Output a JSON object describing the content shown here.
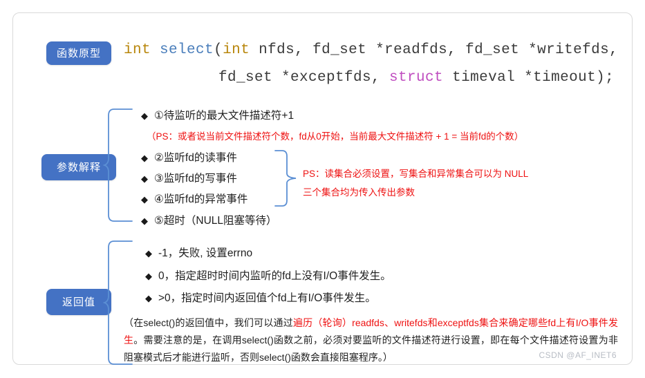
{
  "labels": {
    "prototype": "函数原型",
    "params": "参数解释",
    "return": "返回值"
  },
  "signature": {
    "line1": {
      "kw_int": "int",
      "fn_name": "select",
      "open_paren": "(",
      "kw_int2": "int",
      "rest": " nfds, fd_set *readfds, fd_set *writefds,"
    },
    "line2": {
      "pre": "fd_set *exceptfds, ",
      "kw_struct": "struct",
      "rest": " timeval *timeout);"
    }
  },
  "params_section": {
    "bullets": [
      {
        "marker": "◆",
        "text": "①待监听的最大文件描述符+1"
      },
      {
        "marker": "◆",
        "text": "②监听fd的读事件"
      },
      {
        "marker": "◆",
        "text": "③监听fd的写事件"
      },
      {
        "marker": "◆",
        "text": "④监听fd的异常事件"
      },
      {
        "marker": "◆",
        "text": "⑤超时（NULL阻塞等待）"
      }
    ],
    "ps_note": "（PS：或者说当前文件描述符个数，fd从0开始，当前最大文件描述符 + 1 = 当前fd的个数）",
    "side_note_line1": "PS：读集合必须设置，写集合和异常集合可以为 NULL",
    "side_note_line2": "三个集合均为传入传出参数"
  },
  "return_section": {
    "bullets": [
      {
        "marker": "◆",
        "text": "-1，失败, 设置errno"
      },
      {
        "marker": "◆",
        "text": "0，指定超时时间内监听的fd上没有I/O事件发生。"
      },
      {
        "marker": "◆",
        "text": ">0，指定时间内返回值个fd上有I/O事件发生。"
      }
    ],
    "paragraph": {
      "seg1": "（在select()的返回值中，我们可以通过",
      "seg2_red": "遍历（轮询）readfds、writefds和exceptfds集合来确定哪些fd上有I/O事件发生",
      "seg3": "。需要注意的是，在调用select()函数之前，必须对要监听的文件描述符进行设置，即在每个文件描述符设置为非阻塞模式后才能进行监听，否则select()函数会直接阻塞程序。）"
    }
  },
  "watermark": "CSDN @AF_INET6",
  "colors": {
    "tag_blue": "#4472c4",
    "brace_blue": "#5b8fd4",
    "red": "#ee1111",
    "kw_type": "#b8860b",
    "kw_fn": "#4a7ebb",
    "kw_struct": "#c04fc0",
    "border": "#d9d9d9"
  }
}
